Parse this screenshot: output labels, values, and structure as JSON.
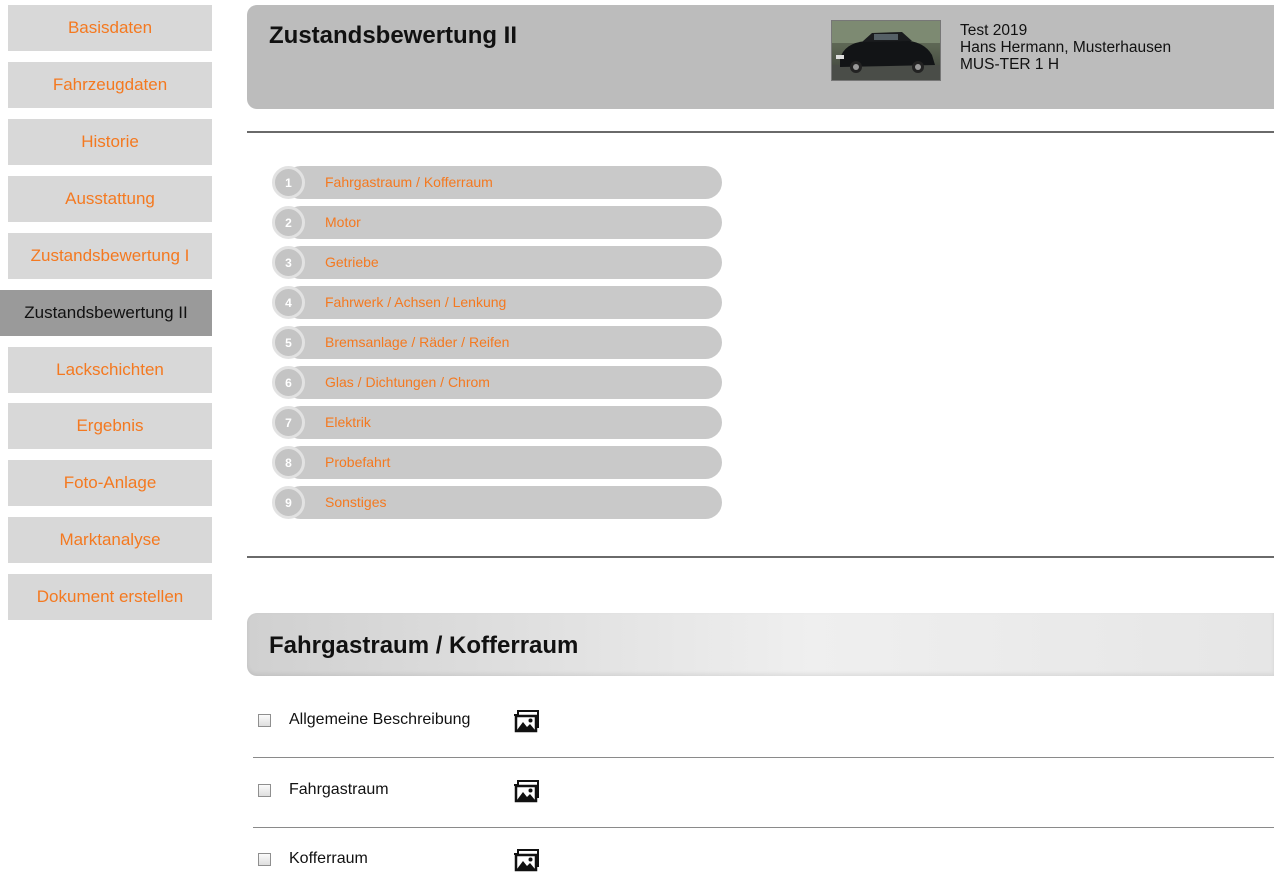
{
  "sidebar": {
    "items": [
      {
        "label": "Basisdaten"
      },
      {
        "label": "Fahrzeugdaten"
      },
      {
        "label": "Historie"
      },
      {
        "label": "Ausstattung"
      },
      {
        "label": "Zustandsbewertung I"
      },
      {
        "label": "Zustandsbewertung II"
      },
      {
        "label": "Lackschichten"
      },
      {
        "label": "Ergebnis"
      },
      {
        "label": "Foto-Anlage"
      },
      {
        "label": "Marktanalyse"
      },
      {
        "label": "Dokument erstellen"
      }
    ],
    "active_index": 5
  },
  "header": {
    "title": "Zustandsbewertung II",
    "info_line1": "Test 2019",
    "info_line2": "Hans Hermann, Musterhausen",
    "info_line3": "MUS-TER 1 H"
  },
  "steps": [
    {
      "number": "1",
      "label": "Fahrgastraum / Kofferraum"
    },
    {
      "number": "2",
      "label": "Motor"
    },
    {
      "number": "3",
      "label": "Getriebe"
    },
    {
      "number": "4",
      "label": "Fahrwerk / Achsen / Lenkung"
    },
    {
      "number": "5",
      "label": "Bremsanlage / Räder / Reifen"
    },
    {
      "number": "6",
      "label": "Glas / Dichtungen / Chrom"
    },
    {
      "number": "7",
      "label": "Elektrik"
    },
    {
      "number": "8",
      "label": "Probefahrt"
    },
    {
      "number": "9",
      "label": "Sonstiges"
    }
  ],
  "section": {
    "title": "Fahrgastraum / Kofferraum",
    "items": [
      {
        "label": "Allgemeine Beschreibung",
        "checked": false,
        "icon": "gallery-icon"
      },
      {
        "label": "Fahrgastraum",
        "checked": false,
        "icon": "gallery-icon"
      },
      {
        "label": "Kofferraum",
        "checked": false,
        "icon": "gallery-icon"
      }
    ]
  },
  "colors": {
    "accent": "#f47920",
    "sidebar_bg": "#d8d8d8",
    "sidebar_active_bg": "#9a9a9a",
    "header_bg": "#bcbcbc"
  }
}
